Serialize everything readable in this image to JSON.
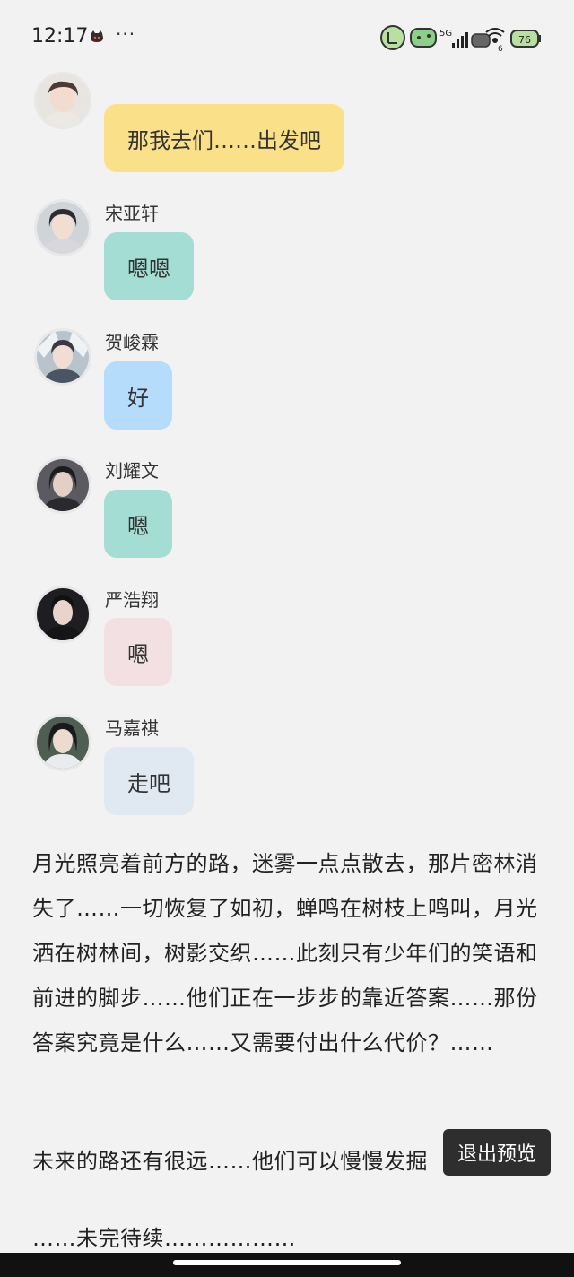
{
  "status_bar": {
    "time": "12:17",
    "dots": "···",
    "network": "5G",
    "wifi_badge": "6"
  },
  "messages": [
    {
      "name": "",
      "text": "那我去们……出发吧",
      "bubble_color": "#fbe08a",
      "avatar_tone": "#c9a8a0"
    },
    {
      "name": "宋亚轩",
      "text": "嗯嗯",
      "bubble_color": "#a3ddd3",
      "avatar_tone": "#9aa3ab"
    },
    {
      "name": "贺峻霖",
      "text": "好",
      "bubble_color": "#b5dcfa",
      "avatar_tone": "#6b7c8c"
    },
    {
      "name": "刘耀文",
      "text": "嗯",
      "bubble_color": "#a3ddd3",
      "avatar_tone": "#3f3f46"
    },
    {
      "name": "严浩翔",
      "text": "嗯",
      "bubble_color": "#f2e0e2",
      "avatar_tone": "#2b2b30"
    },
    {
      "name": "马嘉祺",
      "text": "走吧",
      "bubble_color": "#e0e8f2",
      "avatar_tone": "#5a6a5e"
    }
  ],
  "narration": [
    "月光照亮着前方的路，迷雾一点点散去，那片密林消失了……一切恢复了如初，蝉鸣在树枝上鸣叫，月光洒在树林间，树影交织……此刻只有少年们的笑语和前进的脚步……他们正在一步步的靠近答案……那份答案究竟是什么……又需要付出什么代价？……",
    "未来的路还有很远……他们可以慢慢发掘",
    "……未完待续………………"
  ],
  "exit_button": "退出预览"
}
